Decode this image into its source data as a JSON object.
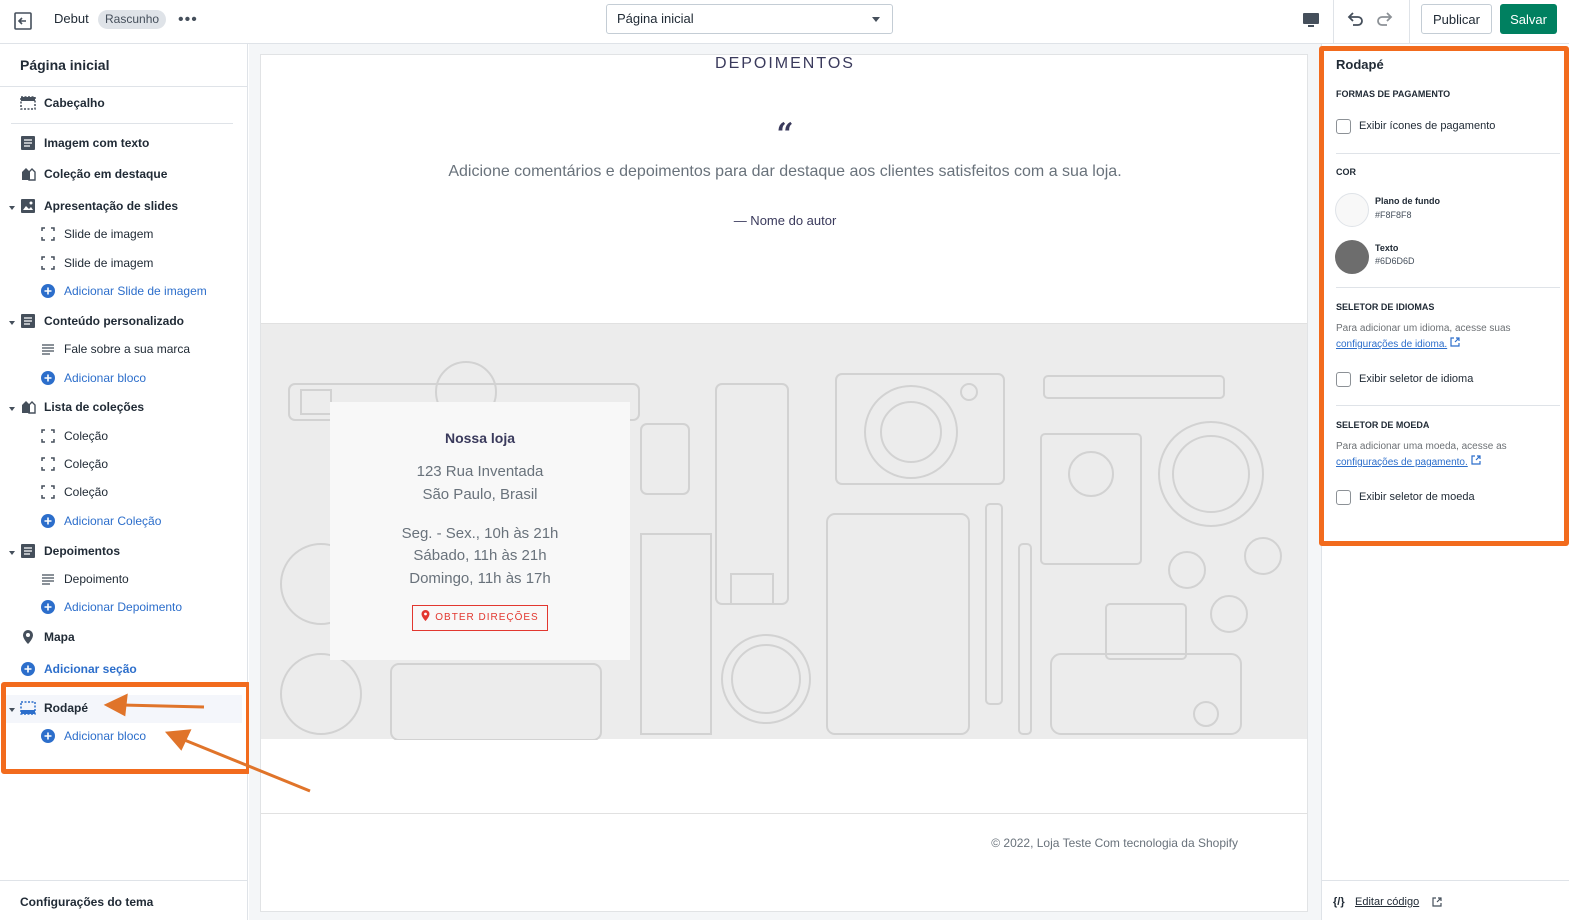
{
  "topbar": {
    "theme_name": "Debut",
    "badge": "Rascunho",
    "more": "•••",
    "page_select": "Página inicial",
    "publish_label": "Publicar",
    "save_label": "Salvar"
  },
  "sidebar": {
    "title": "Página inicial",
    "items": [
      {
        "label": "Cabeçalho",
        "icon": "header-icon"
      },
      {
        "label": "Imagem com texto",
        "icon": "section-icon"
      },
      {
        "label": "Coleção em destaque",
        "icon": "collection-icon"
      },
      {
        "label": "Apresentação de slides",
        "icon": "slideshow-icon"
      },
      {
        "label": "Slide de imagem",
        "icon": "block-icon"
      },
      {
        "label": "Slide de imagem",
        "icon": "block-icon"
      },
      {
        "label": "Adicionar Slide de imagem",
        "icon": "add-icon"
      },
      {
        "label": "Conteúdo personalizado",
        "icon": "section-icon"
      },
      {
        "label": "Fale sobre a sua marca",
        "icon": "text-icon"
      },
      {
        "label": "Adicionar bloco",
        "icon": "add-icon"
      },
      {
        "label": "Lista de coleções",
        "icon": "collection-icon"
      },
      {
        "label": "Coleção",
        "icon": "block-icon"
      },
      {
        "label": "Coleção",
        "icon": "block-icon"
      },
      {
        "label": "Coleção",
        "icon": "block-icon"
      },
      {
        "label": "Adicionar Coleção",
        "icon": "add-icon"
      },
      {
        "label": "Depoimentos",
        "icon": "section-icon"
      },
      {
        "label": "Depoimento",
        "icon": "text-icon"
      },
      {
        "label": "Adicionar Depoimento",
        "icon": "add-icon"
      },
      {
        "label": "Mapa",
        "icon": "map-pin-icon"
      },
      {
        "label": "Adicionar seção",
        "icon": "add-icon"
      },
      {
        "label": "Rodapé",
        "icon": "footer-icon"
      },
      {
        "label": "Adicionar bloco",
        "icon": "add-icon"
      }
    ],
    "footer": "Configurações do tema"
  },
  "preview": {
    "testimonials_heading": "DEPOIMENTOS",
    "quote_mark": "“",
    "testimonial_text": "Adicione comentários e depoimentos para dar destaque aos clientes satisfeitos com a sua loja.",
    "author": "— Nome do autor",
    "store": {
      "title": "Nossa loja",
      "address1": "123 Rua Inventada",
      "address2": "São Paulo, Brasil",
      "hours1": "Seg. - Sex., 10h às 21h",
      "hours2": "Sábado, 11h às 21h",
      "hours3": "Domingo, 11h às 17h",
      "directions": "OBTER DIREÇÕES"
    },
    "copyright": "© 2022, Loja Teste Com tecnologia da Shopify"
  },
  "settings": {
    "title": "Rodapé",
    "payment_heading": "FORMAS DE PAGAMENTO",
    "payment_checkbox": "Exibir ícones de pagamento",
    "color_heading": "COR",
    "bg_label": "Plano de fundo",
    "bg_hex": "#F8F8F8",
    "text_label": "Texto",
    "text_hex": "#6D6D6D",
    "language_heading": "SELETOR DE IDIOMAS",
    "language_help": "Para adicionar um idioma, acesse suas",
    "language_link": "configurações de idioma.",
    "language_checkbox": "Exibir seletor de idioma",
    "currency_heading": "SELETOR DE MOEDA",
    "currency_help": "Para adicionar uma moeda, acesse as",
    "currency_link": "configurações de pagamento.",
    "currency_checkbox": "Exibir seletor de moeda",
    "code_icon": "{/}",
    "edit_code": "Editar código"
  },
  "colors": {
    "accent": "#f26b1d",
    "save_green": "#008060",
    "link_blue": "#2c6ecb",
    "bg_swatch": "#F8F8F8",
    "text_swatch": "#6D6D6D"
  }
}
